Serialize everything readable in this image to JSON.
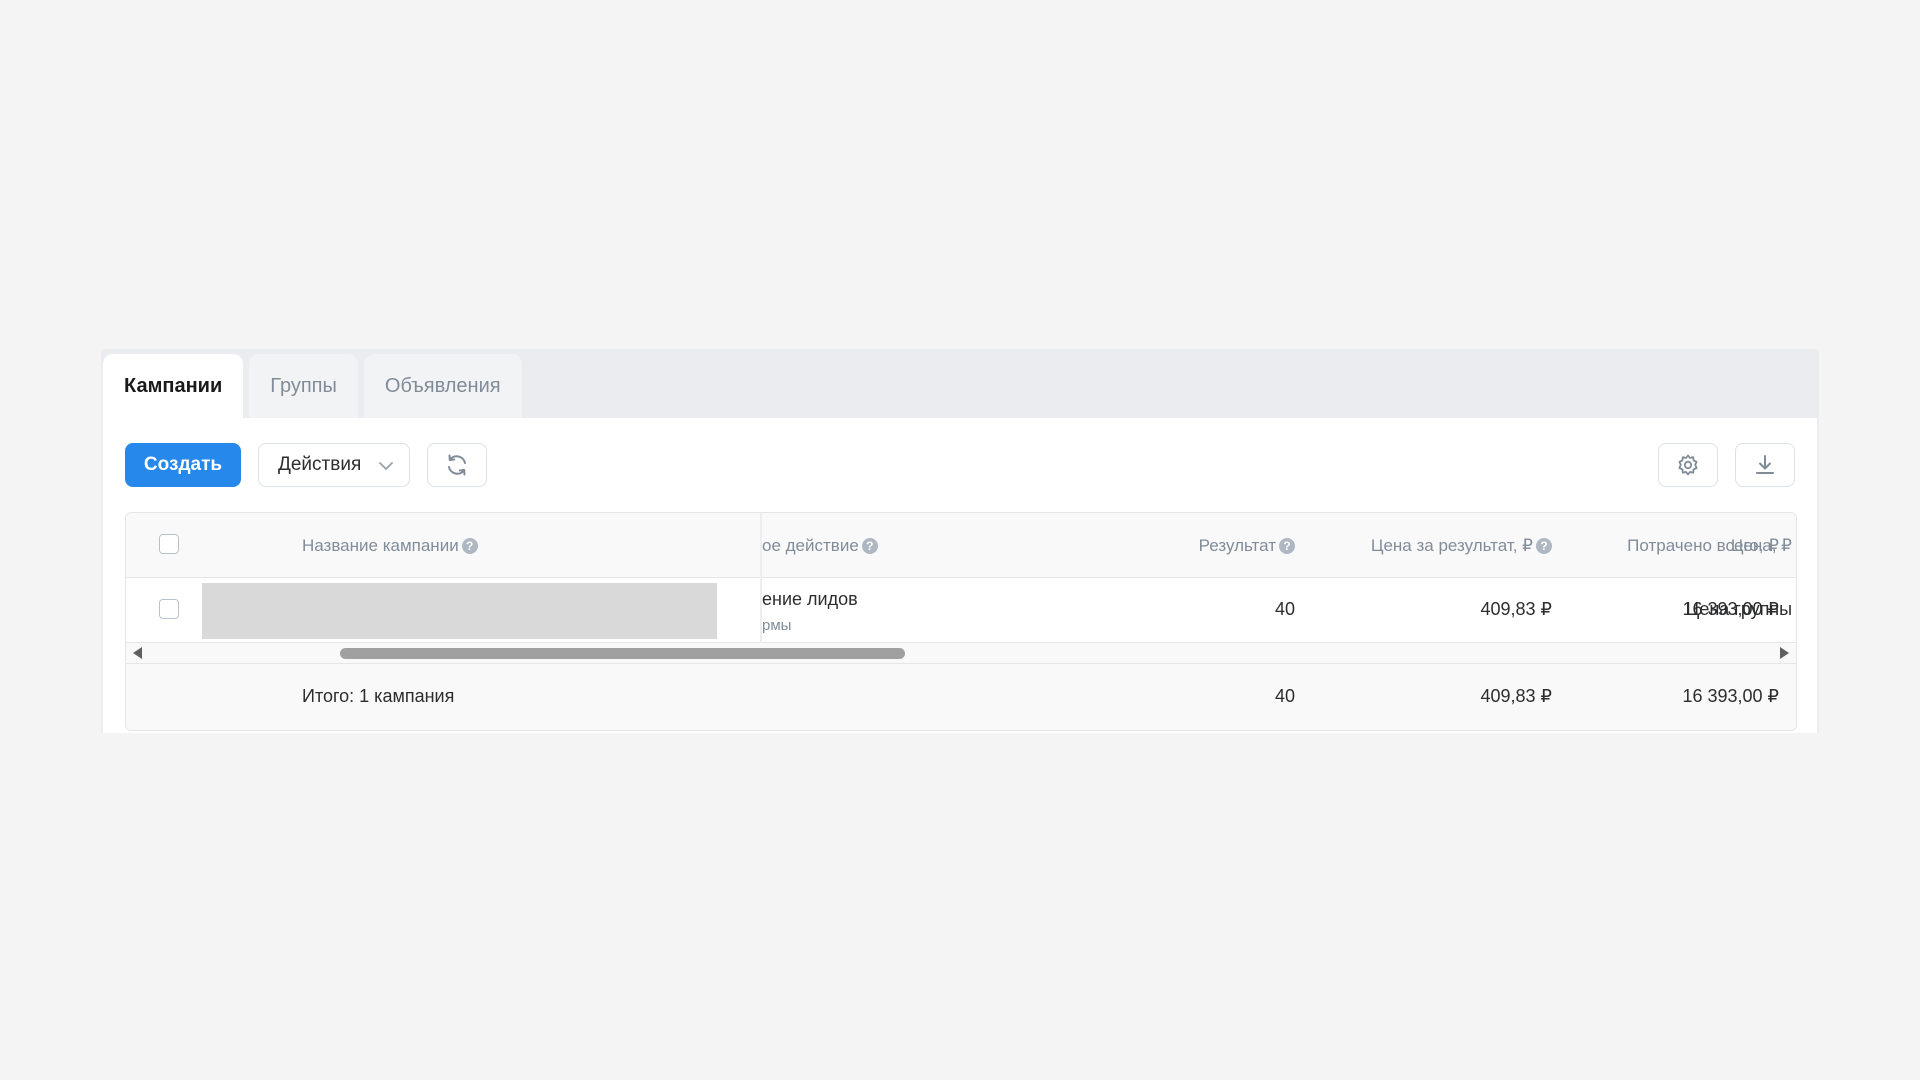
{
  "tabs": [
    {
      "label": "Кампании",
      "active": true
    },
    {
      "label": "Группы",
      "active": false
    },
    {
      "label": "Объявления",
      "active": false
    }
  ],
  "toolbar": {
    "create_label": "Создать",
    "actions_label": "Действия",
    "icons": {
      "actions": "chevron-down-icon",
      "refresh": "refresh-icon",
      "settings": "gear-icon",
      "download": "download-icon"
    }
  },
  "table": {
    "columns": {
      "name": "Название кампании",
      "target_action": "ое действие",
      "result": "Результат",
      "cost_per_result": "Цена за результат, ₽",
      "spent_total": "Потрачено всего, ₽",
      "price": "Цена, ₽"
    },
    "rows": [
      {
        "name": "",
        "target_action": "ение лидов",
        "target_action_sub": "рмы",
        "result": "40",
        "cost_per_result": "409,83 ₽",
        "spent_total": "16 393,00 ₽",
        "price": "Цена группы"
      }
    ],
    "totals": {
      "label": "Итого: 1 кампания",
      "result": "40",
      "cost_per_result": "409,83 ₽",
      "spent_total": "16 393,00 ₽"
    },
    "hint_glyph": "?"
  },
  "colors": {
    "primary": "#2688eb",
    "background": "#f4f4f5",
    "tab_bar": "#ebecef",
    "muted_text": "#818c99",
    "redacted": "#d9d9d9"
  }
}
